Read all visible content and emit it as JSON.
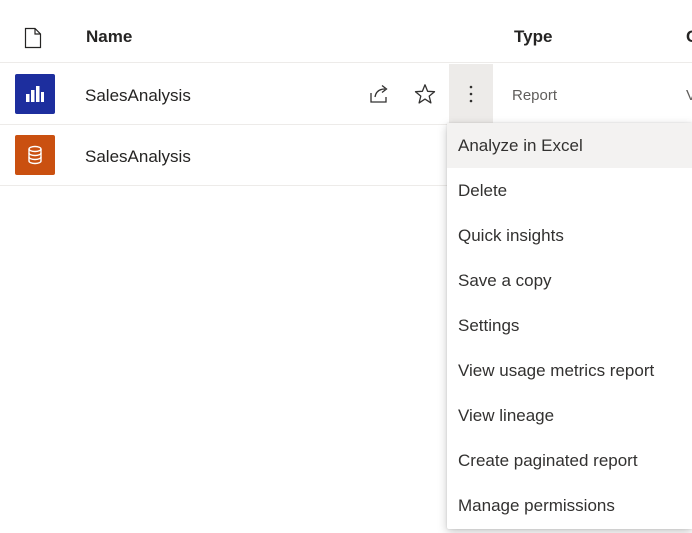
{
  "header": {
    "name": "Name",
    "type": "Type",
    "next_column": "C"
  },
  "rows": [
    {
      "name": "SalesAnalysis",
      "type": "Report",
      "next": "V",
      "icon": "report-icon",
      "color": "#1d2e9e"
    },
    {
      "name": "SalesAnalysis",
      "icon": "dataset-icon",
      "color": "#ca5010"
    }
  ],
  "context_menu": {
    "items": [
      {
        "label": "Analyze in Excel"
      },
      {
        "label": "Delete"
      },
      {
        "label": "Quick insights"
      },
      {
        "label": "Save a copy"
      },
      {
        "label": "Settings"
      },
      {
        "label": "View usage metrics report"
      },
      {
        "label": "View lineage"
      },
      {
        "label": "Create paginated report"
      },
      {
        "label": "Manage permissions"
      }
    ]
  }
}
